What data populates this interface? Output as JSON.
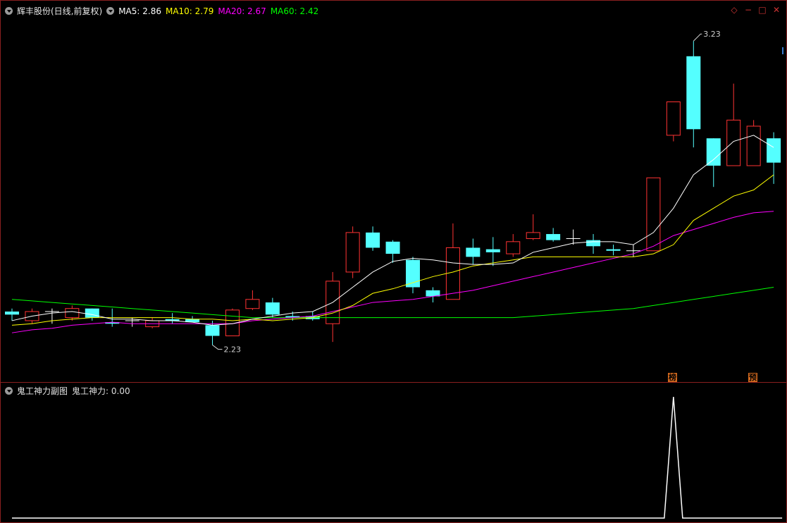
{
  "main": {
    "title": "辉丰股份(日线,前复权)",
    "ma": [
      {
        "label": "MA5: 2.86",
        "color": "#ffffff"
      },
      {
        "label": "MA10: 2.79",
        "color": "#ffff00"
      },
      {
        "label": "MA20: 2.67",
        "color": "#ff00ff"
      },
      {
        "label": "MA60: 2.42",
        "color": "#00ff00"
      }
    ],
    "high_label": "3.23",
    "low_label": "2.23",
    "tags": [
      "榜",
      "预"
    ],
    "icons": [
      "diamond-icon",
      "minimize-icon",
      "restore-icon",
      "close-icon"
    ]
  },
  "sub": {
    "title": "鬼工神力副图",
    "indicator": "鬼工神力: 0.00",
    "peak": 1
  },
  "colors": {
    "up": "#ff3333",
    "down": "#54ffff",
    "ma5": "#ffffff",
    "ma10": "#ffff00",
    "ma20": "#ff00ff",
    "ma60": "#00ff00",
    "frame": "#8a1f1f"
  },
  "chart_data": {
    "type": "candlestick",
    "ylim": [
      2.18,
      3.27
    ],
    "candles": [
      {
        "o": 2.34,
        "c": 2.33,
        "h": 2.35,
        "l": 2.31
      },
      {
        "o": 2.31,
        "c": 2.34,
        "h": 2.35,
        "l": 2.3
      },
      {
        "o": 2.34,
        "c": 2.34,
        "h": 2.35,
        "l": 2.3
      },
      {
        "o": 2.32,
        "c": 2.35,
        "h": 2.36,
        "l": 2.31
      },
      {
        "o": 2.35,
        "c": 2.32,
        "h": 2.35,
        "l": 2.31
      },
      {
        "o": 2.305,
        "c": 2.3,
        "h": 2.35,
        "l": 2.29
      },
      {
        "o": 2.31,
        "c": 2.31,
        "h": 2.32,
        "l": 2.29
      },
      {
        "o": 2.29,
        "c": 2.31,
        "h": 2.32,
        "l": 2.285
      },
      {
        "o": 2.315,
        "c": 2.31,
        "h": 2.335,
        "l": 2.3
      },
      {
        "o": 2.315,
        "c": 2.305,
        "h": 2.325,
        "l": 2.31
      },
      {
        "o": 2.295,
        "c": 2.26,
        "h": 2.31,
        "l": 2.23
      },
      {
        "o": 2.26,
        "c": 2.345,
        "h": 2.35,
        "l": 2.26
      },
      {
        "o": 2.35,
        "c": 2.38,
        "h": 2.41,
        "l": 2.345
      },
      {
        "o": 2.37,
        "c": 2.33,
        "h": 2.385,
        "l": 2.32
      },
      {
        "o": 2.325,
        "c": 2.32,
        "h": 2.34,
        "l": 2.31
      },
      {
        "o": 2.325,
        "c": 2.315,
        "h": 2.34,
        "l": 2.31
      },
      {
        "o": 2.3,
        "c": 2.44,
        "h": 2.47,
        "l": 2.24
      },
      {
        "o": 2.47,
        "c": 2.6,
        "h": 2.62,
        "l": 2.45
      },
      {
        "o": 2.6,
        "c": 2.55,
        "h": 2.62,
        "l": 2.54
      },
      {
        "o": 2.57,
        "c": 2.53,
        "h": 2.575,
        "l": 2.5
      },
      {
        "o": 2.51,
        "c": 2.42,
        "h": 2.52,
        "l": 2.4
      },
      {
        "o": 2.41,
        "c": 2.39,
        "h": 2.42,
        "l": 2.37
      },
      {
        "o": 2.38,
        "c": 2.55,
        "h": 2.63,
        "l": 2.38
      },
      {
        "o": 2.55,
        "c": 2.52,
        "h": 2.58,
        "l": 2.495
      },
      {
        "o": 2.545,
        "c": 2.535,
        "h": 2.585,
        "l": 2.49
      },
      {
        "o": 2.53,
        "c": 2.57,
        "h": 2.595,
        "l": 2.52
      },
      {
        "o": 2.58,
        "c": 2.6,
        "h": 2.66,
        "l": 2.575
      },
      {
        "o": 2.595,
        "c": 2.575,
        "h": 2.615,
        "l": 2.57
      },
      {
        "o": 2.58,
        "c": 2.58,
        "h": 2.61,
        "l": 2.56
      },
      {
        "o": 2.575,
        "c": 2.555,
        "h": 2.595,
        "l": 2.53
      },
      {
        "o": 2.545,
        "c": 2.54,
        "h": 2.56,
        "l": 2.525
      },
      {
        "o": 2.54,
        "c": 2.54,
        "h": 2.56,
        "l": 2.52
      },
      {
        "o": 2.54,
        "c": 2.78,
        "h": 2.78,
        "l": 2.54
      },
      {
        "o": 2.92,
        "c": 3.03,
        "h": 3.03,
        "l": 2.9
      },
      {
        "o": 3.18,
        "c": 2.94,
        "h": 3.23,
        "l": 2.88
      },
      {
        "o": 2.91,
        "c": 2.82,
        "h": 2.91,
        "l": 2.75
      },
      {
        "o": 2.82,
        "c": 2.97,
        "h": 3.09,
        "l": 2.82
      },
      {
        "o": 2.82,
        "c": 2.95,
        "h": 2.97,
        "l": 2.82
      },
      {
        "o": 2.91,
        "c": 2.83,
        "h": 2.93,
        "l": 2.76
      }
    ],
    "ma5": [
      2.31,
      2.325,
      2.335,
      2.34,
      2.33,
      2.315,
      2.315,
      2.31,
      2.31,
      2.305,
      2.295,
      2.3,
      2.315,
      2.325,
      2.335,
      2.34,
      2.37,
      2.42,
      2.47,
      2.505,
      2.515,
      2.51,
      2.5,
      2.495,
      2.495,
      2.5,
      2.535,
      2.55,
      2.565,
      2.57,
      2.57,
      2.56,
      2.6,
      2.68,
      2.79,
      2.84,
      2.9,
      2.92,
      2.88
    ],
    "ma10": [
      2.295,
      2.3,
      2.31,
      2.315,
      2.32,
      2.32,
      2.32,
      2.32,
      2.32,
      2.315,
      2.315,
      2.31,
      2.315,
      2.31,
      2.315,
      2.32,
      2.335,
      2.36,
      2.4,
      2.415,
      2.435,
      2.455,
      2.47,
      2.49,
      2.5,
      2.51,
      2.52,
      2.52,
      2.52,
      2.52,
      2.52,
      2.52,
      2.53,
      2.56,
      2.64,
      2.68,
      2.72,
      2.74,
      2.79
    ],
    "ma20": [
      2.27,
      2.28,
      2.285,
      2.295,
      2.3,
      2.305,
      2.3,
      2.3,
      2.3,
      2.3,
      2.3,
      2.3,
      2.31,
      2.315,
      2.32,
      2.325,
      2.34,
      2.355,
      2.37,
      2.375,
      2.38,
      2.39,
      2.4,
      2.41,
      2.425,
      2.44,
      2.455,
      2.47,
      2.485,
      2.5,
      2.515,
      2.53,
      2.555,
      2.59,
      2.61,
      2.63,
      2.65,
      2.665,
      2.67
    ],
    "ma60": [
      2.38,
      2.375,
      2.37,
      2.365,
      2.36,
      2.355,
      2.35,
      2.345,
      2.34,
      2.335,
      2.33,
      2.325,
      2.32,
      2.32,
      2.32,
      2.32,
      2.32,
      2.32,
      2.32,
      2.32,
      2.32,
      2.32,
      2.32,
      2.32,
      2.32,
      2.32,
      2.325,
      2.33,
      2.335,
      2.34,
      2.345,
      2.35,
      2.36,
      2.37,
      2.38,
      2.39,
      2.4,
      2.41,
      2.42
    ],
    "indicator": [
      0,
      0,
      0,
      0,
      0,
      0,
      0,
      0,
      0,
      0,
      0,
      0,
      0,
      0,
      0,
      0,
      0,
      0,
      0,
      0,
      0,
      0,
      0,
      0,
      0,
      0,
      0,
      0,
      0,
      0,
      0,
      0,
      0,
      1,
      0,
      0,
      0,
      0,
      0
    ]
  }
}
